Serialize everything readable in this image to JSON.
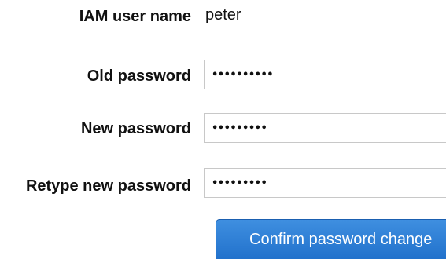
{
  "form": {
    "username_label": "IAM user name",
    "username_value": "peter",
    "old_password_label": "Old password",
    "old_password_value": "••••••••••",
    "new_password_label": "New password",
    "new_password_value": "•••••••••",
    "retype_password_label": "Retype new password",
    "retype_password_value": "•••••••••",
    "confirm_button_label": "Confirm password change"
  },
  "colors": {
    "button_background": "#2b7fd6",
    "button_text": "#ffffff",
    "label_text": "#111111",
    "field_border": "#c8c8c8"
  }
}
